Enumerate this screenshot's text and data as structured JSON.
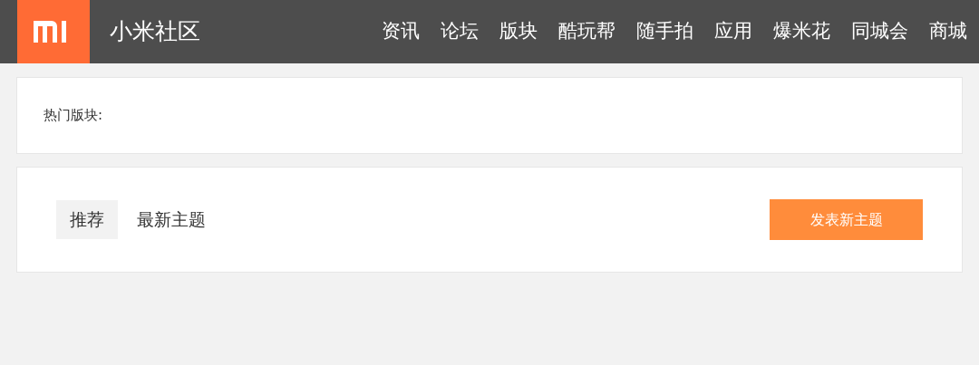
{
  "header": {
    "site_name": "小米社区",
    "nav": [
      {
        "label": "资讯"
      },
      {
        "label": "论坛"
      },
      {
        "label": "版块"
      },
      {
        "label": "酷玩帮"
      },
      {
        "label": "随手拍"
      },
      {
        "label": "应用"
      },
      {
        "label": "爆米花"
      },
      {
        "label": "同城会"
      },
      {
        "label": "商城"
      }
    ]
  },
  "hot_boards": {
    "label": "热门版块:"
  },
  "threads": {
    "tabs": [
      {
        "label": "推荐",
        "selected": true
      },
      {
        "label": "最新主题",
        "selected": false
      }
    ],
    "new_post_button": "发表新主题"
  }
}
